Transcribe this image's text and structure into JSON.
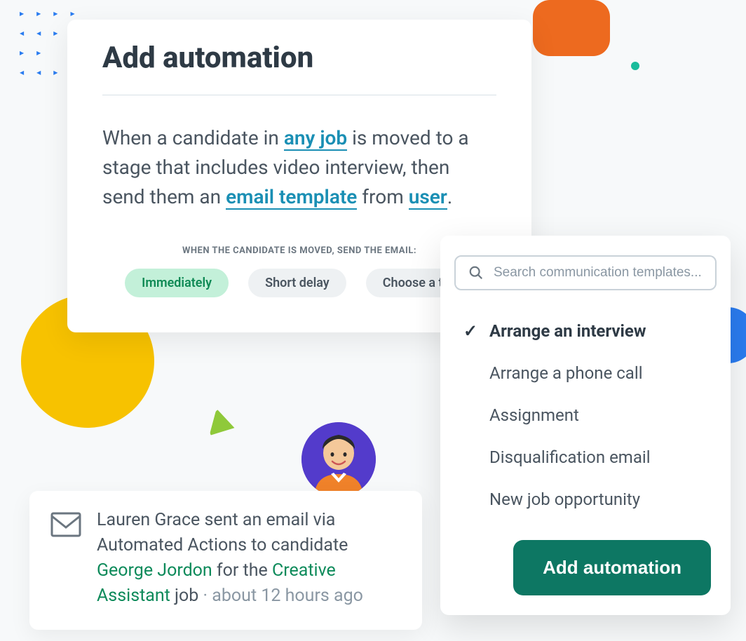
{
  "automation": {
    "title": "Add automation",
    "sentence": {
      "part1": "When a candidate in ",
      "token_job": "any job",
      "part2": " is moved to a stage that includes video interview, then send them an ",
      "token_template": "email template",
      "part3": " from ",
      "token_user": "user",
      "part4": "."
    },
    "timing": {
      "label": "WHEN THE CANDIDATE IS MOVED, SEND THE EMAIL:",
      "options": [
        {
          "label": "Immediately",
          "active": true
        },
        {
          "label": "Short delay",
          "active": false
        },
        {
          "label": "Choose a tim",
          "active": false
        }
      ]
    }
  },
  "dropdown": {
    "search_placeholder": "Search communication templates...",
    "items": [
      {
        "label": "Arrange an interview",
        "selected": true
      },
      {
        "label": "Arrange a phone call",
        "selected": false
      },
      {
        "label": "Assignment",
        "selected": false
      },
      {
        "label": "Disqualification email",
        "selected": false
      },
      {
        "label": "New job opportunity",
        "selected": false
      }
    ],
    "button": "Add automation"
  },
  "activity": {
    "text1": "Lauren Grace sent an email via Automated Actions to candidate ",
    "candidate": "George Jordon",
    "text2": " for the ",
    "job": "Creative Assistant",
    "text3": " job",
    "separator": " · ",
    "time": "about 12 hours ago"
  }
}
